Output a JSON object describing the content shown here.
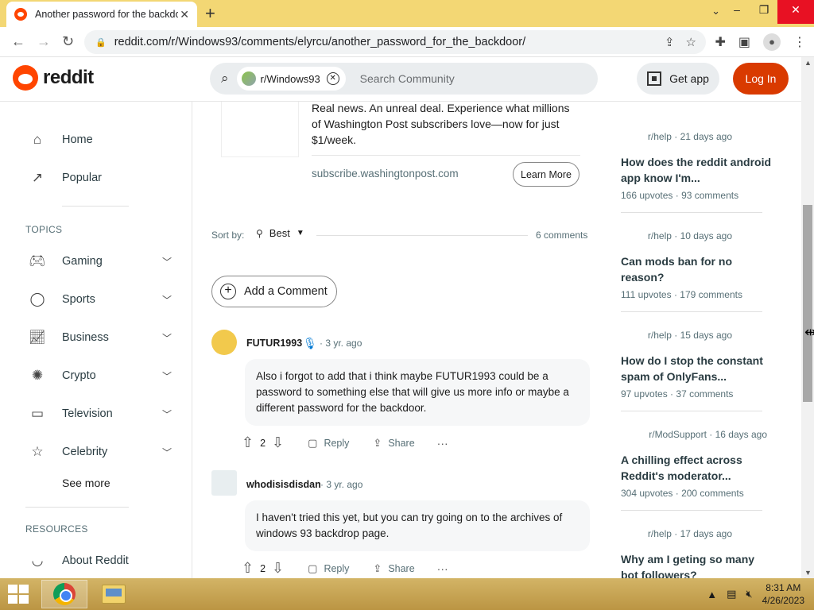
{
  "browser": {
    "tab_title": "Another password for the backdoor",
    "tab_close": "✕",
    "new_tab": "+",
    "url": "reddit.com/r/Windows93/comments/elyrcu/another_password_for_the_backdoor/",
    "window_controls": {
      "dropdown": "⌄",
      "minimize": "–",
      "maximize": "❐",
      "close": "✕"
    },
    "icons": {
      "back": "back-arrow-icon",
      "forward": "forward-arrow-icon",
      "reload": "reload-icon",
      "lock": "lock-icon",
      "share": "share-icon",
      "star": "star-icon",
      "extensions": "puzzle-icon",
      "sidepanel": "sidepanel-icon",
      "profile": "profile-icon",
      "menu": "kebab-menu-icon"
    }
  },
  "reddit_header": {
    "wordmark": "reddit",
    "search_chip": "r/Windows93",
    "search_placeholder": "Search Community",
    "get_app": "Get app",
    "login": "Log In",
    "accent": "#d93a00"
  },
  "left_nav": {
    "items_top": [
      {
        "label": "Home",
        "icon": "home-icon"
      },
      {
        "label": "Popular",
        "icon": "popular-icon"
      }
    ],
    "topics_label": "TOPICS",
    "topics": [
      {
        "label": "Gaming",
        "icon": "gamepad-icon"
      },
      {
        "label": "Sports",
        "icon": "ball-icon"
      },
      {
        "label": "Business",
        "icon": "chart-icon"
      },
      {
        "label": "Crypto",
        "icon": "crypto-icon"
      },
      {
        "label": "Television",
        "icon": "tv-icon"
      },
      {
        "label": "Celebrity",
        "icon": "star-icon"
      }
    ],
    "see_more": "See more",
    "resources_label": "RESOURCES",
    "resources": [
      {
        "label": "About Reddit",
        "icon": "about-icon"
      }
    ]
  },
  "ad": {
    "text": "Real news. An unreal deal. Experience what millions of Washington Post subscribers love—now for just $1/week.",
    "domain": "subscribe.washingtonpost.com",
    "cta": "Learn More"
  },
  "sort": {
    "label": "Sort by:",
    "value": "Best",
    "comment_count": "6 comments"
  },
  "add_comment": "Add a Comment",
  "comments": [
    {
      "author": "FUTUR1993",
      "age": "3 yr. ago",
      "body": "Also i forgot to add that i think maybe FUTUR1993 could be a password to something else that will give us more info or maybe a different password for the backdoor.",
      "score": "2",
      "reply": "Reply",
      "share": "Share"
    },
    {
      "author": "whodisisdisdan",
      "age": "3 yr. ago",
      "body": "I haven't tried this yet, but you can try going on to the archives of windows 93 backdrop page.",
      "score": "2",
      "reply": "Reply",
      "share": "Share"
    }
  ],
  "related": [
    {
      "sub": "r/help · 21 days ago",
      "title": "How does the reddit android app know I'm...",
      "upvotes": "166 upvotes",
      "comments": "93 comments"
    },
    {
      "sub": "r/help · 10 days ago",
      "title": "Can mods ban for no reason?",
      "upvotes": "111 upvotes",
      "comments": "179 comments"
    },
    {
      "sub": "r/help · 15 days ago",
      "title": "How do I stop the constant spam of OnlyFans...",
      "upvotes": "97 upvotes",
      "comments": "37 comments"
    },
    {
      "sub": "r/ModSupport · 16 days ago",
      "title": "A chilling effect across Reddit's moderator...",
      "upvotes": "304 upvotes",
      "comments": "200 comments"
    },
    {
      "sub": "r/help · 17 days ago",
      "title": "Why am I geting so many bot followers?",
      "upvotes": "",
      "comments": ""
    }
  ],
  "taskbar": {
    "time": "8:31 AM",
    "date": "4/26/2023"
  }
}
